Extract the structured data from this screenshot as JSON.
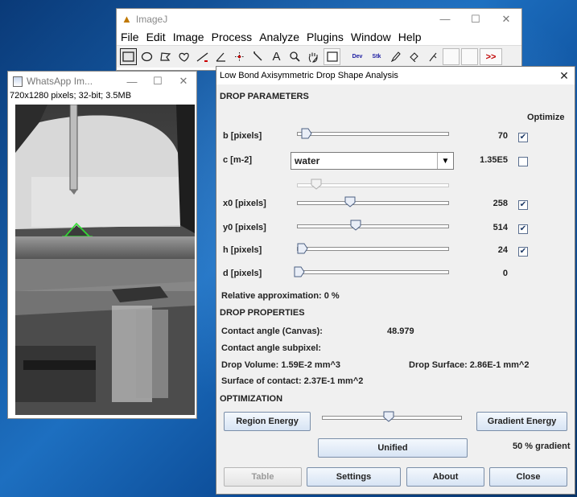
{
  "imagej": {
    "title": "ImageJ",
    "menu": [
      "File",
      "Edit",
      "Image",
      "Process",
      "Analyze",
      "Plugins",
      "Window",
      "Help"
    ],
    "tools": [
      "rectangle-tool",
      "oval-tool",
      "polygon-tool",
      "freehand-tool",
      "line-tool",
      "angle-tool",
      "multipoint-tool",
      "wand-tool",
      "text-tool",
      "magnifier-tool",
      "scroll-tool",
      "color-picker-tool",
      "dev-menu",
      "stk-menu",
      "pencil-tool",
      "brush-tool",
      "flood-tool",
      "more-tools"
    ],
    "dev_label": "Dev",
    "stk_label": "Stk",
    "more_label": ">>"
  },
  "image_window": {
    "title": "WhatsApp Im...",
    "info": "720x1280 pixels; 32-bit; 3.5MB"
  },
  "dialog": {
    "title": "Low Bond Axisymmetric Drop Shape Analysis",
    "drop_parameters_title": "DROP PARAMETERS",
    "optimize_header": "Optimize",
    "params": [
      {
        "label": "b [pixels]",
        "value": "70",
        "optimize": true,
        "slider_fraction": 0.05
      },
      {
        "label": "x0 [pixels]",
        "value": "258",
        "optimize": true,
        "slider_fraction": 0.36
      },
      {
        "label": "y0 [pixels]",
        "value": "514",
        "optimize": true,
        "slider_fraction": 0.4
      },
      {
        "label": "h [pixels]",
        "value": "24",
        "optimize": true,
        "slider_fraction": 0.02
      },
      {
        "label": "d [pixels]",
        "value": "0",
        "optimize": null,
        "slider_fraction": 0.0
      }
    ],
    "c_label": "c [m-2]",
    "c_selected": "water",
    "c_value": "1.35E5",
    "c_optimize": false,
    "c_slider_fraction": 0.12,
    "relative_approximation": "Relative approximation: 0 %",
    "drop_properties_title": "DROP PROPERTIES",
    "contact_angle_canvas_label": "Contact angle (Canvas):",
    "contact_angle_canvas_value": "48.979",
    "contact_angle_subpixel_label": "Contact angle subpixel:",
    "drop_volume": "Drop Volume: 1.59E-2 mm^3",
    "drop_surface": "Drop Surface: 2.86E-1 mm^2",
    "surface_of_contact": "Surface of contact: 2.37E-1 mm^2",
    "optimization_title": "OPTIMIZATION",
    "region_energy_label": "Region Energy",
    "gradient_energy_label": "Gradient Energy",
    "optimization_slider_fraction": 0.5,
    "unified_label": "Unified",
    "gradient_percent": "50 % gradient",
    "buttons": {
      "table": "Table",
      "settings": "Settings",
      "about": "About",
      "close": "Close"
    }
  },
  "window_controls": {
    "minimize": "—",
    "maximize": "☐",
    "close": "✕"
  },
  "colors": {
    "accent_button": "#d7e4f4",
    "checkbox_mark": "#1f3a66",
    "detection_overlay": "#2fe02f"
  }
}
